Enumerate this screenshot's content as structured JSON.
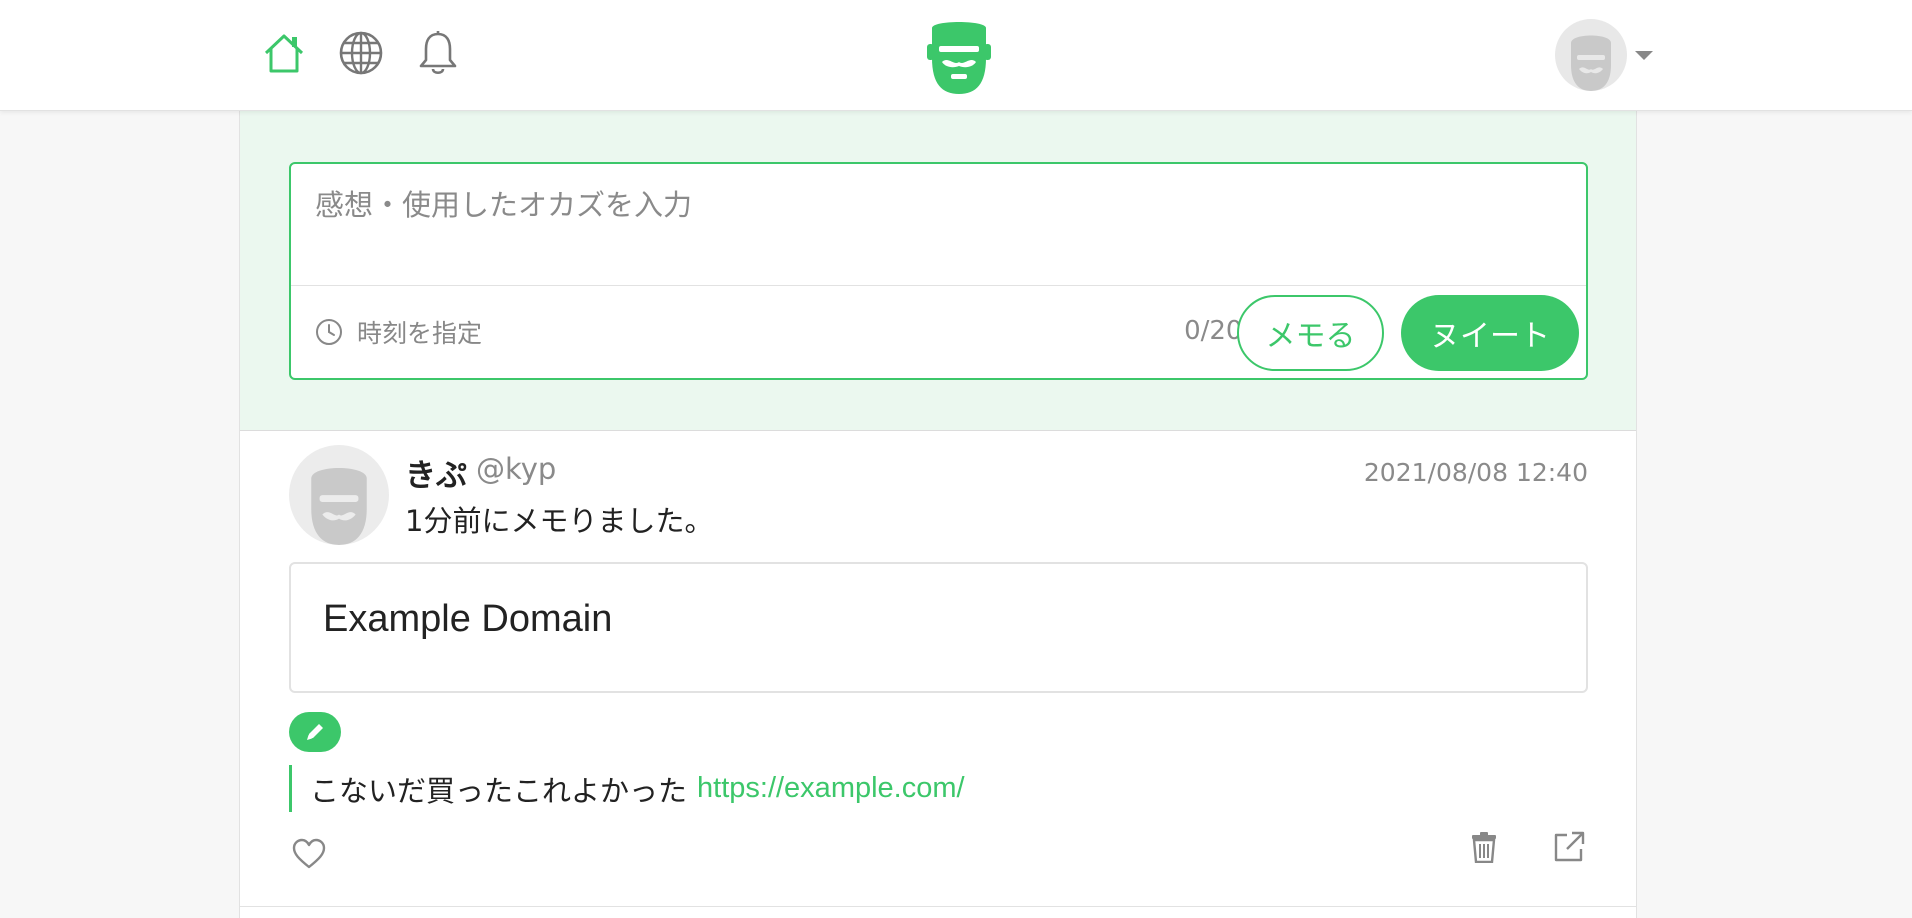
{
  "colors": {
    "accent": "#3cc76a",
    "composer_bg": "#ebf8ef",
    "muted": "#8a8a8a"
  },
  "navbar": {
    "icons": [
      "home-icon",
      "globe-icon",
      "bell-icon"
    ],
    "logo": "bearded-face-logo",
    "account_avatar": "default-avatar",
    "account_caret": "caret-down-icon"
  },
  "composer": {
    "placeholder": "感想・使用したオカズを入力",
    "schedule_label": "時刻を指定",
    "char_count": "0/200",
    "memo_button": "メモる",
    "tweet_button": "ヌイート"
  },
  "post": {
    "display_name": "きぷ",
    "handle": "@kyp",
    "timestamp": "2021/08/08 12:40",
    "text": "1分前にメモりました。",
    "link_card_title": "Example Domain",
    "memo_text": "こないだ買ったこれよかった",
    "memo_link": "https://example.com/",
    "actions": [
      "heart-icon",
      "trash-icon",
      "external-link-icon"
    ]
  }
}
